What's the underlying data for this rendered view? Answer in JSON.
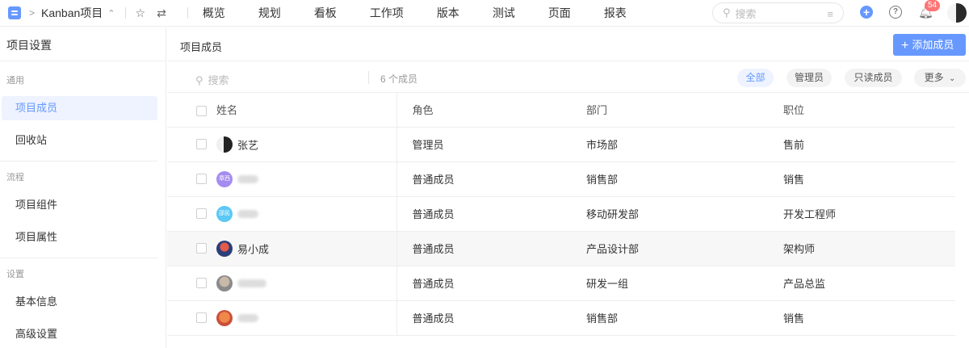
{
  "topbar": {
    "project_name": "Kanban项目",
    "nav": [
      "概览",
      "规划",
      "看板",
      "工作项",
      "版本",
      "测试",
      "页面",
      "报表"
    ],
    "search_placeholder": "搜索",
    "notification_count": "54"
  },
  "sidebar": {
    "title": "项目设置",
    "sections": [
      {
        "label": "通用",
        "items": [
          "项目成员",
          "回收站"
        ]
      },
      {
        "label": "流程",
        "items": [
          "项目组件",
          "项目属性"
        ]
      },
      {
        "label": "设置",
        "items": [
          "基本信息",
          "高级设置"
        ]
      }
    ]
  },
  "main": {
    "title": "项目成员",
    "add_button": "添加成员",
    "search_placeholder": "搜索",
    "member_count": "6 个成员",
    "filters": {
      "all": "全部",
      "admin": "管理员",
      "readonly": "只读成员",
      "more": "更多"
    },
    "columns": [
      "姓名",
      "角色",
      "部门",
      "职位"
    ],
    "rows": [
      {
        "name": "张艺",
        "avatar_text": "",
        "role": "管理员",
        "dept": "市场部",
        "title": "售前"
      },
      {
        "name": "",
        "avatar_text": "章西",
        "role": "普通成员",
        "dept": "销售部",
        "title": "销售"
      },
      {
        "name": "",
        "avatar_text": "邵民",
        "role": "普通成员",
        "dept": "移动研发部",
        "title": "开发工程师"
      },
      {
        "name": "易小成",
        "avatar_text": "",
        "role": "普通成员",
        "dept": "产品设计部",
        "title": "架构师"
      },
      {
        "name": "",
        "avatar_text": "",
        "role": "普通成员",
        "dept": "研发一组",
        "title": "产品总监"
      },
      {
        "name": "",
        "avatar_text": "",
        "role": "普通成员",
        "dept": "销售部",
        "title": "销售"
      }
    ]
  },
  "colors": {
    "accent": "#6698ff",
    "badge": "#ff7575",
    "active_bg": "#eef3ff"
  }
}
